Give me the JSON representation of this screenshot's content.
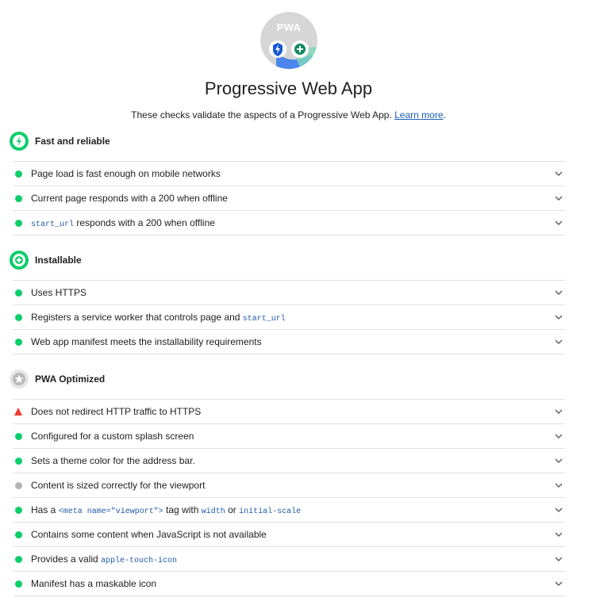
{
  "header": {
    "badge_label": "PWA",
    "title": "Progressive Web App",
    "description": "These checks validate the aspects of a Progressive Web App.",
    "learn_more": "Learn more",
    "description_end": "."
  },
  "colors": {
    "pass": "#0cce6b",
    "fail": "#f33b2f",
    "na": "#b3b3b3",
    "link": "#1a5fb4",
    "code": "#1f5aa8"
  },
  "groups": [
    {
      "icon": "fast-reliable-icon",
      "title": "Fast and reliable",
      "audits": [
        {
          "status": "pass",
          "text": "Page load is fast enough on mobile networks"
        },
        {
          "status": "pass",
          "text": "Current page responds with a 200 when offline"
        },
        {
          "status": "pass",
          "code": "start_url",
          "text": " responds with a 200 when offline"
        }
      ]
    },
    {
      "icon": "installable-icon",
      "title": "Installable",
      "audits": [
        {
          "status": "pass",
          "text": "Uses HTTPS"
        },
        {
          "status": "pass",
          "text": "Registers a service worker that controls page and ",
          "code": "start_url"
        },
        {
          "status": "pass",
          "text": "Web app manifest meets the installability requirements"
        }
      ]
    },
    {
      "icon": "pwa-optimized-icon",
      "title": "PWA Optimized",
      "audits": [
        {
          "status": "fail",
          "text": "Does not redirect HTTP traffic to HTTPS"
        },
        {
          "status": "pass",
          "text": "Configured for a custom splash screen"
        },
        {
          "status": "pass",
          "text": "Sets a theme color for the address bar."
        },
        {
          "status": "na",
          "text": "Content is sized correctly for the viewport"
        },
        {
          "status": "pass",
          "text_1": "Has a ",
          "code_1": "<meta name=\"viewport\">",
          "text_2": " tag with ",
          "code_2": "width",
          "text_3": " or ",
          "code_3": "initial-scale"
        },
        {
          "status": "pass",
          "text": "Contains some content when JavaScript is not available"
        },
        {
          "status": "pass",
          "text": "Provides a valid ",
          "code": "apple-touch-icon"
        },
        {
          "status": "pass",
          "text": "Manifest has a maskable icon"
        }
      ]
    }
  ]
}
